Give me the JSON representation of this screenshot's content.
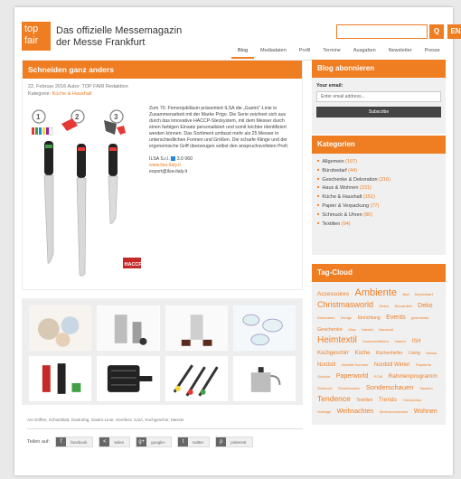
{
  "header": {
    "logo_line1": "top",
    "logo_line2": "fair",
    "tagline_line1": "Das offizielle Messemagazin",
    "tagline_line2": "der Messe Frankfurt",
    "search_placeholder": "",
    "search_button": "Q",
    "lang": "EN"
  },
  "nav": [
    {
      "label": "Blog"
    },
    {
      "label": "Mediadaten"
    },
    {
      "label": "Profil"
    },
    {
      "label": "Termine"
    },
    {
      "label": "Ausgaben"
    },
    {
      "label": "Newsletter"
    },
    {
      "label": "Presse"
    }
  ],
  "article": {
    "title": "Schneiden ganz anders",
    "meta_line1": "22. Februar 2016 Autor: TOP FAIR Redaktion",
    "category_prefix": "Kategorie: ",
    "category": "Küche & Haushalt",
    "body": "Zum 70. Firmenjubiläum präsentiert ILSA die „Gastrò“-Linie in Zusammenarbeit mit der Marke Prigo. Die Serie zeichnet sich aus durch das innovative HACCP-Steckystem, mit dem Messer durch einen farbigen Einsatz personalisiert und somit leichter identifiziert werden können. Das Sortiment umfasst mehr als 25 Messer in unterschiedlichen Formen und Größen. Die scharfe Klinge und der ergonomische Griff überzeugen selbst den anspruchsvollsten Profi.",
    "company": "ILSA S.r.l.",
    "stand": "3.0 060",
    "website": "www.ilsa-italy.it",
    "email": "export@ilsa-italy.it",
    "haccp": "HACCP",
    "steps": [
      "1",
      "2",
      "3"
    ],
    "tags": "Am Griffen, Schutzblatt, Gastrològ, Gastrò-Linie, Hornfess, ILSA, Kochgeschirr, Messer",
    "share_label": "Teilen auf:",
    "share_buttons": [
      {
        "icon": "f",
        "label": "facebook"
      },
      {
        "icon": "<",
        "label": "teilen"
      },
      {
        "icon": "g+",
        "label": "google+"
      },
      {
        "icon": "t",
        "label": "twitter"
      },
      {
        "icon": "p",
        "label": "pinterest"
      }
    ]
  },
  "subscribe": {
    "title": "Blog abonnieren",
    "email_label": "Your email:",
    "email_placeholder": "Enter email address...",
    "button": "Subscribe"
  },
  "categories": {
    "title": "Kategorien",
    "items": [
      {
        "label": "Allgemein",
        "count": "(107)"
      },
      {
        "label": "Bürobedarf",
        "count": "(44)"
      },
      {
        "label": "Geschenke & Dekoration",
        "count": "(216)"
      },
      {
        "label": "Haus & Wohnen",
        "count": "(231)"
      },
      {
        "label": "Küche & Haushalt",
        "count": "(151)"
      },
      {
        "label": "Papier & Verpackung",
        "count": "(77)"
      },
      {
        "label": "Schmuck & Uhren",
        "count": "(86)"
      },
      {
        "label": "Textilien",
        "count": "(94)"
      }
    ]
  },
  "tagcloud": {
    "title": "Tag-Cloud",
    "words": [
      {
        "t": "Accessoires",
        "s": 6.5
      },
      {
        "t": "Ambiente",
        "s": 11
      },
      {
        "t": "Bad",
        "s": 4
      },
      {
        "t": "Bürobedarf",
        "s": 4
      },
      {
        "t": "Christmasworld",
        "s": 9
      },
      {
        "t": "Dekor",
        "s": 4
      },
      {
        "t": "Büroartikel",
        "s": 4
      },
      {
        "t": "Deko",
        "s": 7
      },
      {
        "t": "Dekoration",
        "s": 4
      },
      {
        "t": "Design",
        "s": 4
      },
      {
        "t": "Einrichtung",
        "s": 5
      },
      {
        "t": "Events",
        "s": 7
      },
      {
        "t": "geschenke",
        "s": 4
      },
      {
        "t": "Geschenke",
        "s": 5.5
      },
      {
        "t": "Glas",
        "s": 4
      },
      {
        "t": "Handel",
        "s": 4
      },
      {
        "t": "Haushalt",
        "s": 4
      },
      {
        "t": "Heimtextil",
        "s": 10
      },
      {
        "t": "Innenarchitektur",
        "s": 4
      },
      {
        "t": "Interior",
        "s": 4
      },
      {
        "t": "ISH",
        "s": 6
      },
      {
        "t": "Kochgeschirr",
        "s": 6
      },
      {
        "t": "Küche",
        "s": 6
      },
      {
        "t": "Küchenhelfer",
        "s": 5
      },
      {
        "t": "Living",
        "s": 5
      },
      {
        "t": "Messe",
        "s": 4
      },
      {
        "t": "Nordstil",
        "s": 6
      },
      {
        "t": "Nordstil Sommer",
        "s": 4
      },
      {
        "t": "Nordstil Winter",
        "s": 6
      },
      {
        "t": "Papeterie",
        "s": 4
      },
      {
        "t": "Outdoor",
        "s": 4
      },
      {
        "t": "Paperworld",
        "s": 7
      },
      {
        "t": "PCW",
        "s": 4
      },
      {
        "t": "Rahmenprogramm",
        "s": 6.5
      },
      {
        "t": "Schmuck",
        "s": 4
      },
      {
        "t": "Schreibwaren",
        "s": 4
      },
      {
        "t": "Sonderschauen",
        "s": 7.5
      },
      {
        "t": "Taschen",
        "s": 4
      },
      {
        "t": "Tendence",
        "s": 8.5
      },
      {
        "t": "Textilien",
        "s": 5
      },
      {
        "t": "Trends",
        "s": 6.5
      },
      {
        "t": "Trendschau",
        "s": 4
      },
      {
        "t": "Vorträge",
        "s": 4
      },
      {
        "t": "Weihnachten",
        "s": 7
      },
      {
        "t": "Wohnaccessoires",
        "s": 4
      },
      {
        "t": "Wohnen",
        "s": 7
      }
    ]
  },
  "colors": {
    "accent": "#ef7d22",
    "dark": "#444444"
  }
}
